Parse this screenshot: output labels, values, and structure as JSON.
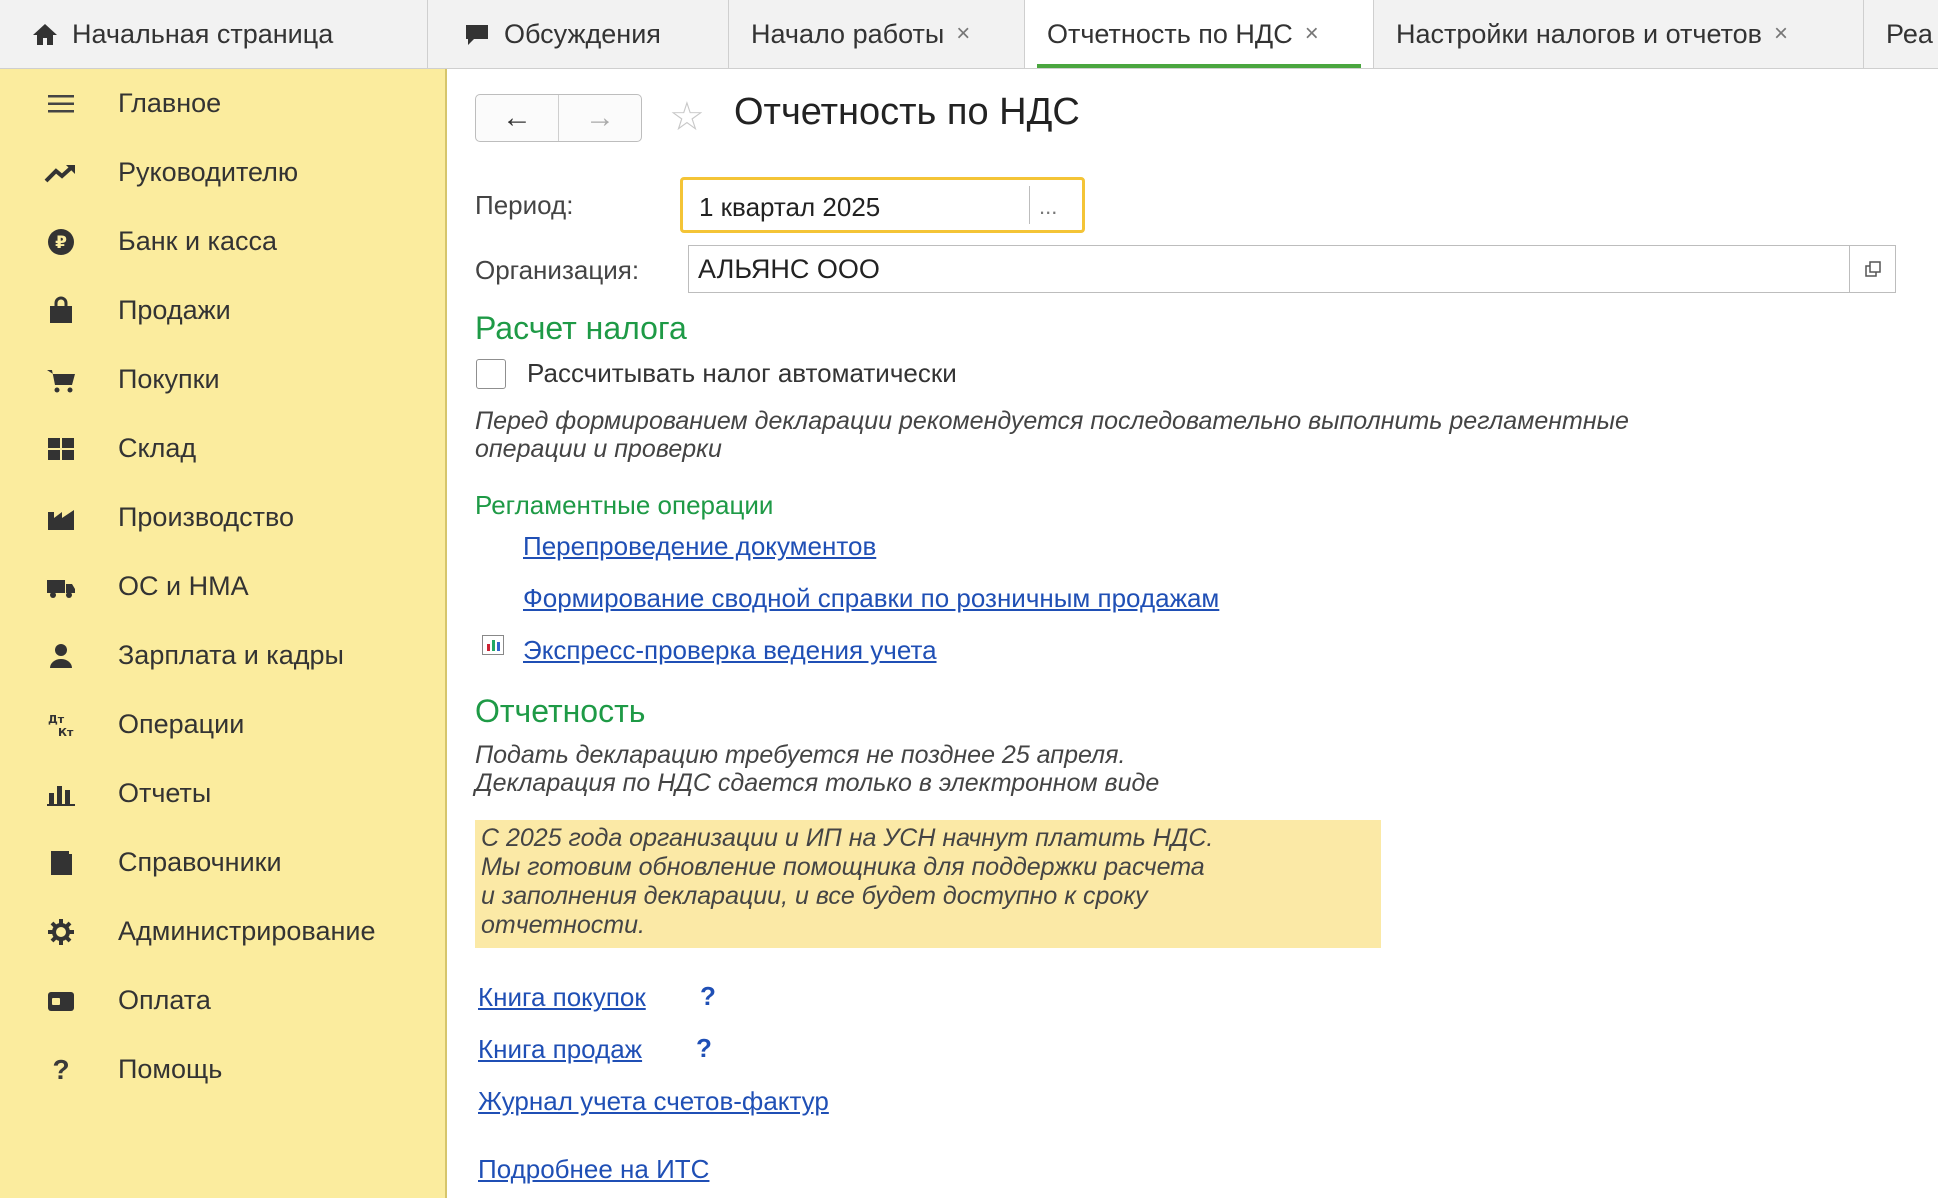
{
  "tabs": [
    {
      "label": "Начальная страница",
      "icon": "home-icon"
    },
    {
      "label": "Обсуждения",
      "icon": "chat-icon"
    },
    {
      "label": "Начало работы",
      "close": "×"
    },
    {
      "label": "Отчетность по НДС",
      "close": "×",
      "active": true
    },
    {
      "label": "Настройки налогов и отчетов",
      "close": "×"
    },
    {
      "label": "Реа"
    }
  ],
  "sidebar": {
    "items": [
      {
        "label": "Главное",
        "icon": "menu-icon"
      },
      {
        "label": "Руководителю",
        "icon": "trend-icon"
      },
      {
        "label": "Банк и касса",
        "icon": "ruble-icon"
      },
      {
        "label": "Продажи",
        "icon": "bag-icon"
      },
      {
        "label": "Покупки",
        "icon": "cart-icon"
      },
      {
        "label": "Склад",
        "icon": "warehouse-icon"
      },
      {
        "label": "Производство",
        "icon": "factory-icon"
      },
      {
        "label": "ОС и НМА",
        "icon": "truck-icon"
      },
      {
        "label": "Зарплата и кадры",
        "icon": "person-icon"
      },
      {
        "label": "Операции",
        "icon": "dt-kt-icon",
        "icon_text": "Дт\nКт"
      },
      {
        "label": "Отчеты",
        "icon": "bar-chart-icon"
      },
      {
        "label": "Справочники",
        "icon": "book-icon"
      },
      {
        "label": "Администрирование",
        "icon": "gear-icon"
      },
      {
        "label": "Оплата",
        "icon": "wallet-icon"
      },
      {
        "label": "Помощь",
        "icon": "help-icon",
        "icon_text": "?"
      }
    ]
  },
  "main": {
    "title": "Отчетность по НДС",
    "period_label": "Период:",
    "period_value": "1 квартал 2025",
    "period_button": "...",
    "org_label": "Организация:",
    "org_value": "АЛЬЯНС ООО",
    "tax_section": "Расчет налога",
    "auto_calc_label": "Рассчитывать налог автоматически",
    "auto_calc_checked": false,
    "recommend_line1": "Перед формированием декларации рекомендуется последовательно выполнить регламентные",
    "recommend_line2": "операции и проверки",
    "reg_ops_title": "Регламентные операции",
    "link_repost": "Перепроведение документов",
    "link_summary": "Формирование сводной справки по розничным продажам",
    "link_express": "Экспресс-проверка ведения учета",
    "reporting_section": "Отчетность",
    "deadline_line1": "Подать декларацию требуется не позднее 25 апреля.",
    "deadline_line2": "Декларация по НДС сдается только в электронном виде",
    "warning_lines": [
      "С 2025 года организации и ИП на УСН начнут платить НДС.",
      "Мы готовим обновление помощника для поддержки расчета",
      "и заполнения декларации, и все будет доступно к сроку",
      "отчетности."
    ],
    "link_purchases": "Книга покупок",
    "link_sales": "Книга продаж",
    "help_mark": "?",
    "link_invoices": "Журнал учета счетов-фактур",
    "link_its": "Подробнее на ИТС"
  },
  "colors": {
    "sidebar_bg": "#fbec9e",
    "accent_green": "#1e9a46",
    "link_blue": "#1f4fb5",
    "active_tab_underline": "#4aa63f",
    "period_focus": "#f4c436",
    "warning_bg": "#fbe9a6"
  }
}
